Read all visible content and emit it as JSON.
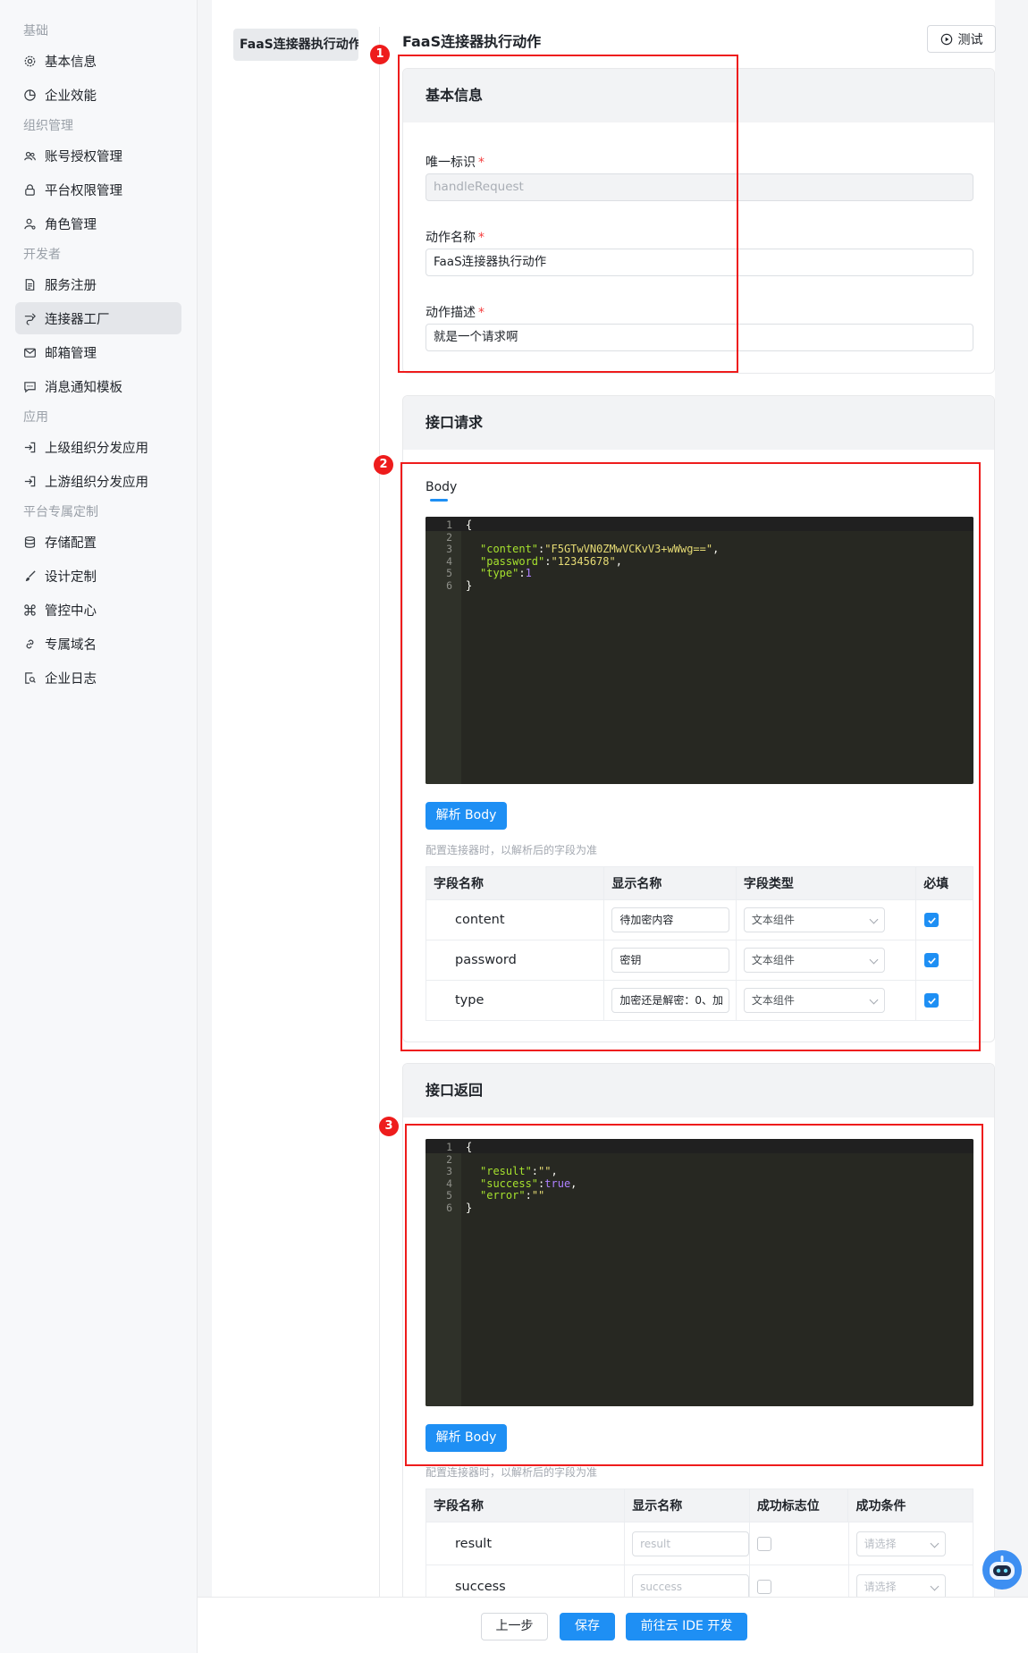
{
  "sidebar": {
    "groups": [
      {
        "label": "基础",
        "items": [
          {
            "label": "基本信息",
            "icon": "gear-icon"
          },
          {
            "label": "企业效能",
            "icon": "pie-chart-icon"
          }
        ]
      },
      {
        "label": "组织管理",
        "items": [
          {
            "label": "账号授权管理",
            "icon": "users-icon"
          },
          {
            "label": "平台权限管理",
            "icon": "lock-icon"
          },
          {
            "label": "角色管理",
            "icon": "user-role-icon"
          }
        ]
      },
      {
        "label": "开发者",
        "items": [
          {
            "label": "服务注册",
            "icon": "document-icon"
          },
          {
            "label": "连接器工厂",
            "icon": "connector-icon",
            "active": true
          },
          {
            "label": "邮箱管理",
            "icon": "mail-icon"
          },
          {
            "label": "消息通知模板",
            "icon": "message-icon"
          }
        ]
      },
      {
        "label": "应用",
        "items": [
          {
            "label": "上级组织分发应用",
            "icon": "login-icon"
          },
          {
            "label": "上游组织分发应用",
            "icon": "login-icon"
          }
        ]
      },
      {
        "label": "平台专属定制",
        "items": [
          {
            "label": "存储配置",
            "icon": "database-icon"
          },
          {
            "label": "设计定制",
            "icon": "brush-icon"
          },
          {
            "label": "管控中心",
            "icon": "command-icon"
          },
          {
            "label": "专属域名",
            "icon": "link-icon"
          },
          {
            "label": "企业日志",
            "icon": "log-search-icon"
          }
        ]
      }
    ]
  },
  "action_tab": "FaaS连接器执行动作",
  "page_title": "FaaS连接器执行动作",
  "test_button": "测试",
  "basic_info": {
    "title": "基本信息",
    "fields": [
      {
        "label": "唯一标识",
        "required": "*",
        "value": "handleRequest",
        "disabled": true
      },
      {
        "label": "动作名称",
        "required": "*",
        "value": "FaaS连接器执行动作"
      },
      {
        "label": "动作描述",
        "required": "*",
        "value": "就是一个请求啊"
      }
    ]
  },
  "request": {
    "title": "接口请求",
    "tab": "Body",
    "code_lines": [
      {
        "n": "1",
        "text": "{"
      },
      {
        "n": "2",
        "text": ""
      },
      {
        "n": "3",
        "key": "\"content\"",
        "val": "\"F5GTwVN0ZMwVCKvV3+wWwg==\"",
        "type": "s",
        "tail": ","
      },
      {
        "n": "4",
        "key": "\"password\"",
        "val": "\"12345678\"",
        "type": "s",
        "tail": ","
      },
      {
        "n": "5",
        "key": "\"type\"",
        "val": "1",
        "type": "n",
        "tail": ""
      },
      {
        "n": "6",
        "text": "}"
      }
    ],
    "parse_button": "解析 Body",
    "hint": "配置连接器时，以解析后的字段为准",
    "columns": [
      "字段名称",
      "显示名称",
      "字段类型",
      "必填"
    ],
    "rows": [
      {
        "name": "content",
        "display": "待加密内容",
        "type": "文本组件",
        "required": true
      },
      {
        "name": "password",
        "display": "密钥",
        "type": "文本组件",
        "required": true
      },
      {
        "name": "type",
        "display": "加密还是解密：0、加",
        "type": "文本组件",
        "required": true
      }
    ]
  },
  "response": {
    "title": "接口返回",
    "code_lines": [
      {
        "n": "1",
        "text": "{"
      },
      {
        "n": "2",
        "text": ""
      },
      {
        "n": "3",
        "key": "\"result\"",
        "val": "\"\"",
        "type": "s",
        "tail": ","
      },
      {
        "n": "4",
        "key": "\"success\"",
        "val": "true",
        "type": "n",
        "tail": ","
      },
      {
        "n": "5",
        "key": "\"error\"",
        "val": "\"\"",
        "type": "s",
        "tail": ""
      },
      {
        "n": "6",
        "text": "}"
      }
    ],
    "parse_button": "解析 Body",
    "hint": "配置连接器时，以解析后的字段为准",
    "columns": [
      "字段名称",
      "显示名称",
      "成功标志位",
      "成功条件"
    ],
    "rows": [
      {
        "name": "result",
        "display_placeholder": "result",
        "select_placeholder": "请选择"
      },
      {
        "name": "success",
        "display_placeholder": "success",
        "select_placeholder": "请选择"
      }
    ]
  },
  "annotations": [
    "1",
    "2",
    "3"
  ],
  "footer": {
    "prev": "上一步",
    "save": "保存",
    "ide": "前往云 IDE 开发"
  },
  "colors": {
    "primary": "#1e8ff4",
    "annotation": "#ee1c1c",
    "required": "#f53f3f",
    "code_bg": "#272822"
  }
}
